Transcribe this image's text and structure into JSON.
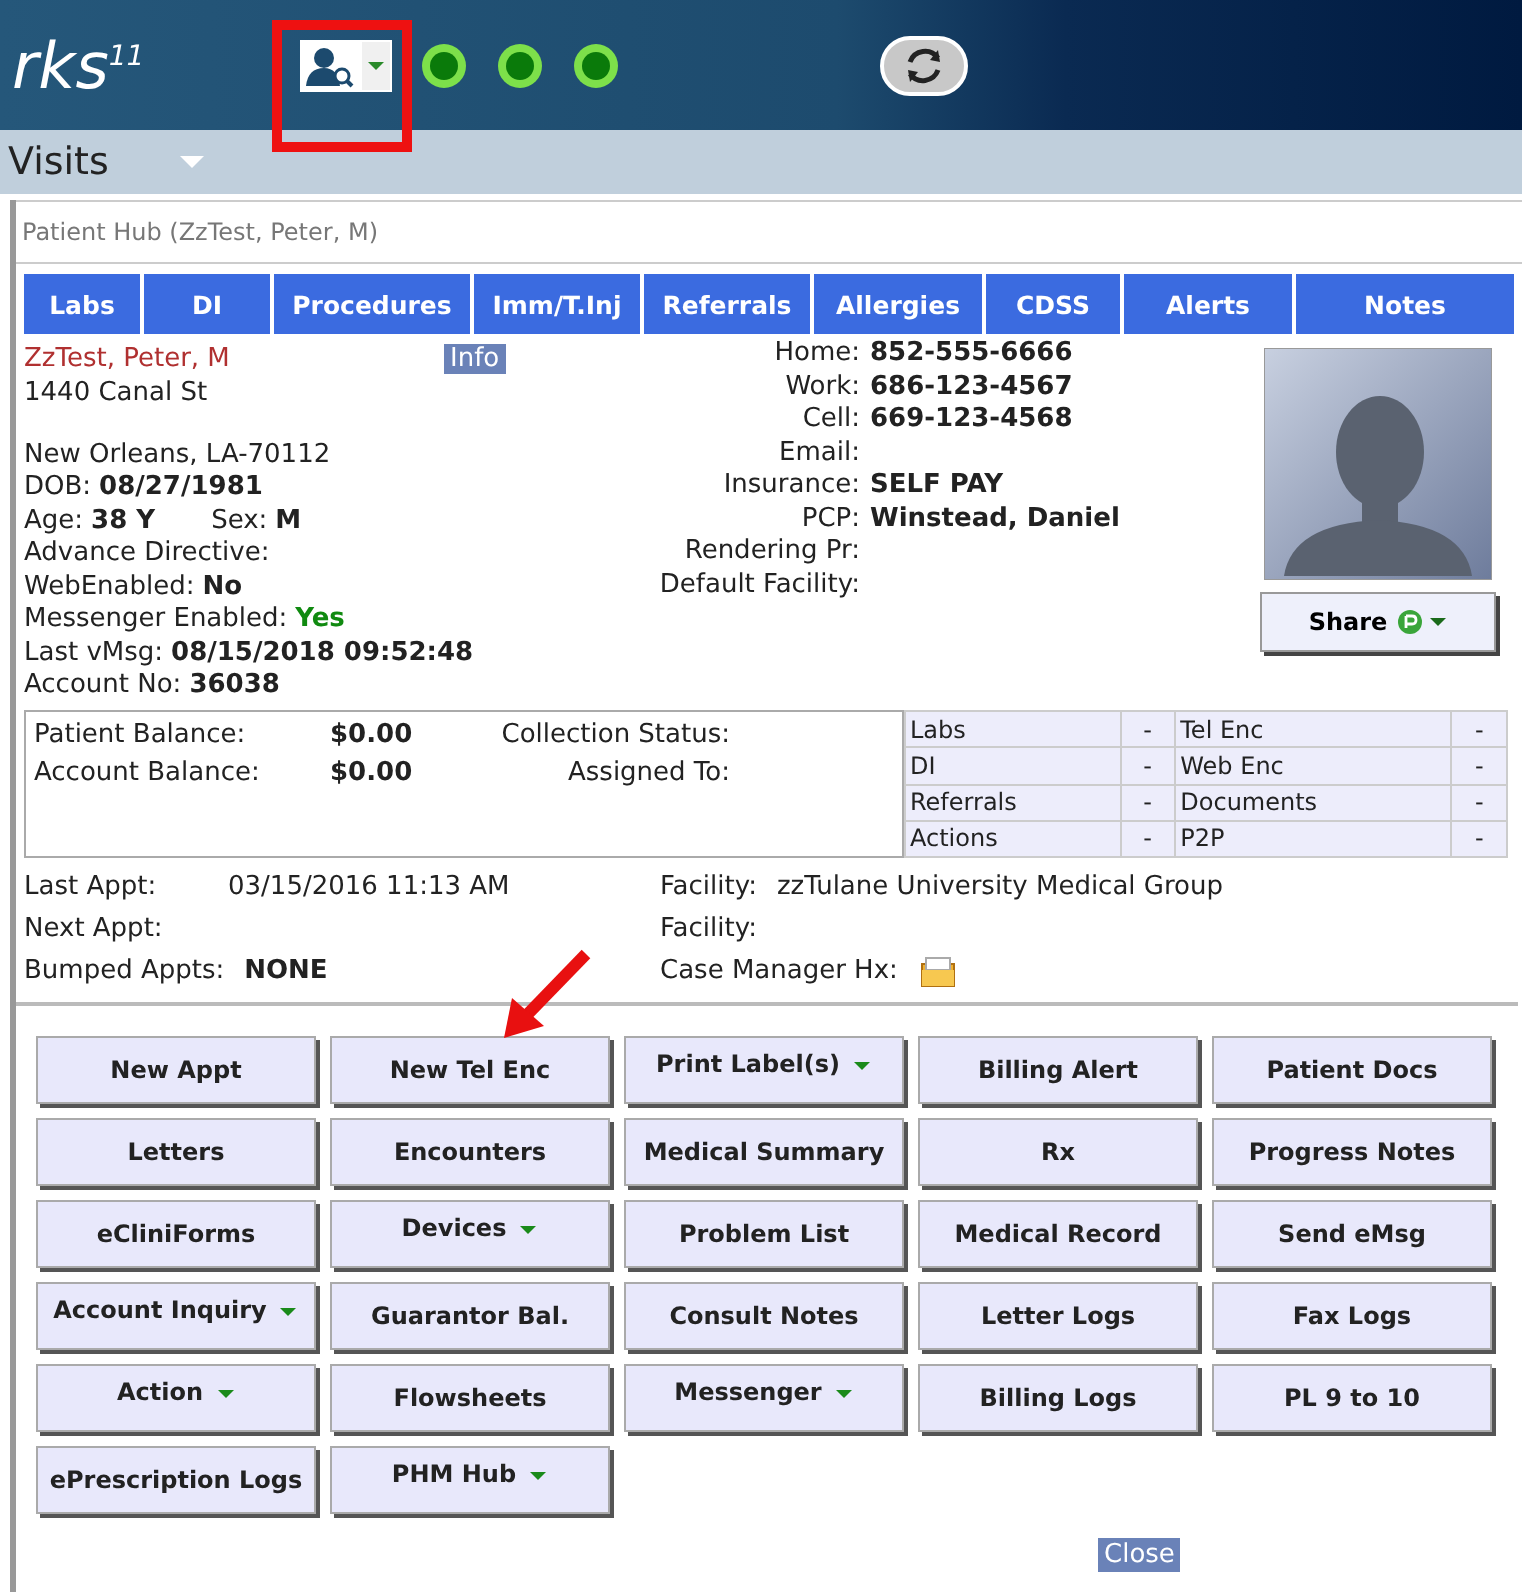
{
  "header": {
    "logo_text": "rks",
    "logo_superscript": "11"
  },
  "menu": {
    "label": "Visits"
  },
  "hub_title": "Patient Hub (ZzTest, Peter, M)",
  "tabs": [
    "Labs",
    "DI",
    "Procedures",
    "Imm/T.Inj",
    "Referrals",
    "Allergies",
    "CDSS",
    "Alerts",
    "Notes"
  ],
  "patient": {
    "name": "ZzTest, Peter, M",
    "info_button": "Info",
    "address": "1440 Canal St",
    "city": "New Orleans, LA-70112",
    "fields": [
      [
        {
          "label": "DOB:",
          "value": "08/27/1981"
        }
      ],
      [
        {
          "label": "Age:",
          "value": "38 Y"
        },
        {
          "label": "Sex:",
          "value": "M"
        }
      ],
      [
        {
          "label": "Advance Directive:"
        }
      ],
      [
        {
          "label": "WebEnabled:",
          "value": "No"
        }
      ],
      [
        {
          "label": "Messenger Enabled:",
          "value": "Yes",
          "color": "#108a10"
        }
      ],
      [
        {
          "label": "Last vMsg:",
          "value": "08/15/2018 09:52:48"
        }
      ],
      [
        {
          "label": "Account No:",
          "value": "36038"
        }
      ]
    ],
    "contacts": [
      {
        "label": "Home:",
        "value": "852-555-6666"
      },
      {
        "label": "Work:",
        "value": "686-123-4567"
      },
      {
        "label": "Cell:",
        "value": "669-123-4568"
      },
      {
        "label": "Email:"
      },
      {
        "label": "Insurance:",
        "value": "SELF PAY"
      },
      {
        "label": "PCP:",
        "value": "Winstead, Daniel"
      },
      {
        "label": "Rendering Pr:"
      },
      {
        "label": "Default Facility:"
      }
    ],
    "share_button": "Share"
  },
  "balance": {
    "rows": [
      {
        "label": "Patient Balance:",
        "value": "$0.00",
        "status_label": "Collection Status:"
      },
      {
        "label": "Account Balance:",
        "value": "$0.00",
        "status_label": "Assigned To:"
      }
    ],
    "counts": [
      [
        "Labs",
        "-",
        "Tel Enc",
        "-"
      ],
      [
        "DI",
        "-",
        "Web Enc",
        "-"
      ],
      [
        "Referrals",
        "-",
        "Documents",
        "-"
      ],
      [
        "Actions",
        "-",
        "P2P",
        "-"
      ]
    ]
  },
  "appointments": {
    "left": [
      {
        "label": "Last Appt:",
        "value": "03/15/2016 11:13 AM",
        "bold": false
      },
      {
        "label": "Next Appt:"
      },
      {
        "label": "Bumped Appts:",
        "value": "NONE",
        "bold": true
      }
    ],
    "right": [
      {
        "label": "Facility:",
        "value": "zzTulane University Medical Group"
      },
      {
        "label": "Facility:"
      },
      {
        "label": "Case Manager Hx:",
        "kind": "icon"
      }
    ]
  },
  "buttons": [
    {
      "label": "New Appt",
      "dropdown": false
    },
    {
      "label": "New Tel Enc",
      "dropdown": false
    },
    {
      "label": "Print Label(s)",
      "dropdown": true
    },
    {
      "label": "Billing Alert",
      "dropdown": false
    },
    {
      "label": "Patient Docs",
      "dropdown": false
    },
    {
      "label": "Letters",
      "dropdown": false
    },
    {
      "label": "Encounters",
      "dropdown": false
    },
    {
      "label": "Medical Summary",
      "dropdown": false
    },
    {
      "label": "Rx",
      "dropdown": false
    },
    {
      "label": "Progress Notes",
      "dropdown": false
    },
    {
      "label": "eCliniForms",
      "dropdown": false
    },
    {
      "label": "Devices",
      "dropdown": true
    },
    {
      "label": "Problem List",
      "dropdown": false
    },
    {
      "label": "Medical Record",
      "dropdown": false
    },
    {
      "label": "Send eMsg",
      "dropdown": false
    },
    {
      "label": "Account Inquiry",
      "dropdown": true
    },
    {
      "label": "Guarantor Bal.",
      "dropdown": false
    },
    {
      "label": "Consult Notes",
      "dropdown": false
    },
    {
      "label": "Letter Logs",
      "dropdown": false
    },
    {
      "label": "Fax Logs",
      "dropdown": false
    },
    {
      "label": "Action",
      "dropdown": true
    },
    {
      "label": "Flowsheets",
      "dropdown": false
    },
    {
      "label": "Messenger",
      "dropdown": true
    },
    {
      "label": "Billing Logs",
      "dropdown": false
    },
    {
      "label": "PL 9 to 10",
      "dropdown": false
    },
    {
      "label": "ePrescription Logs",
      "dropdown": false
    },
    {
      "label": "PHM Hub",
      "dropdown": true
    }
  ],
  "close_button": "Close"
}
